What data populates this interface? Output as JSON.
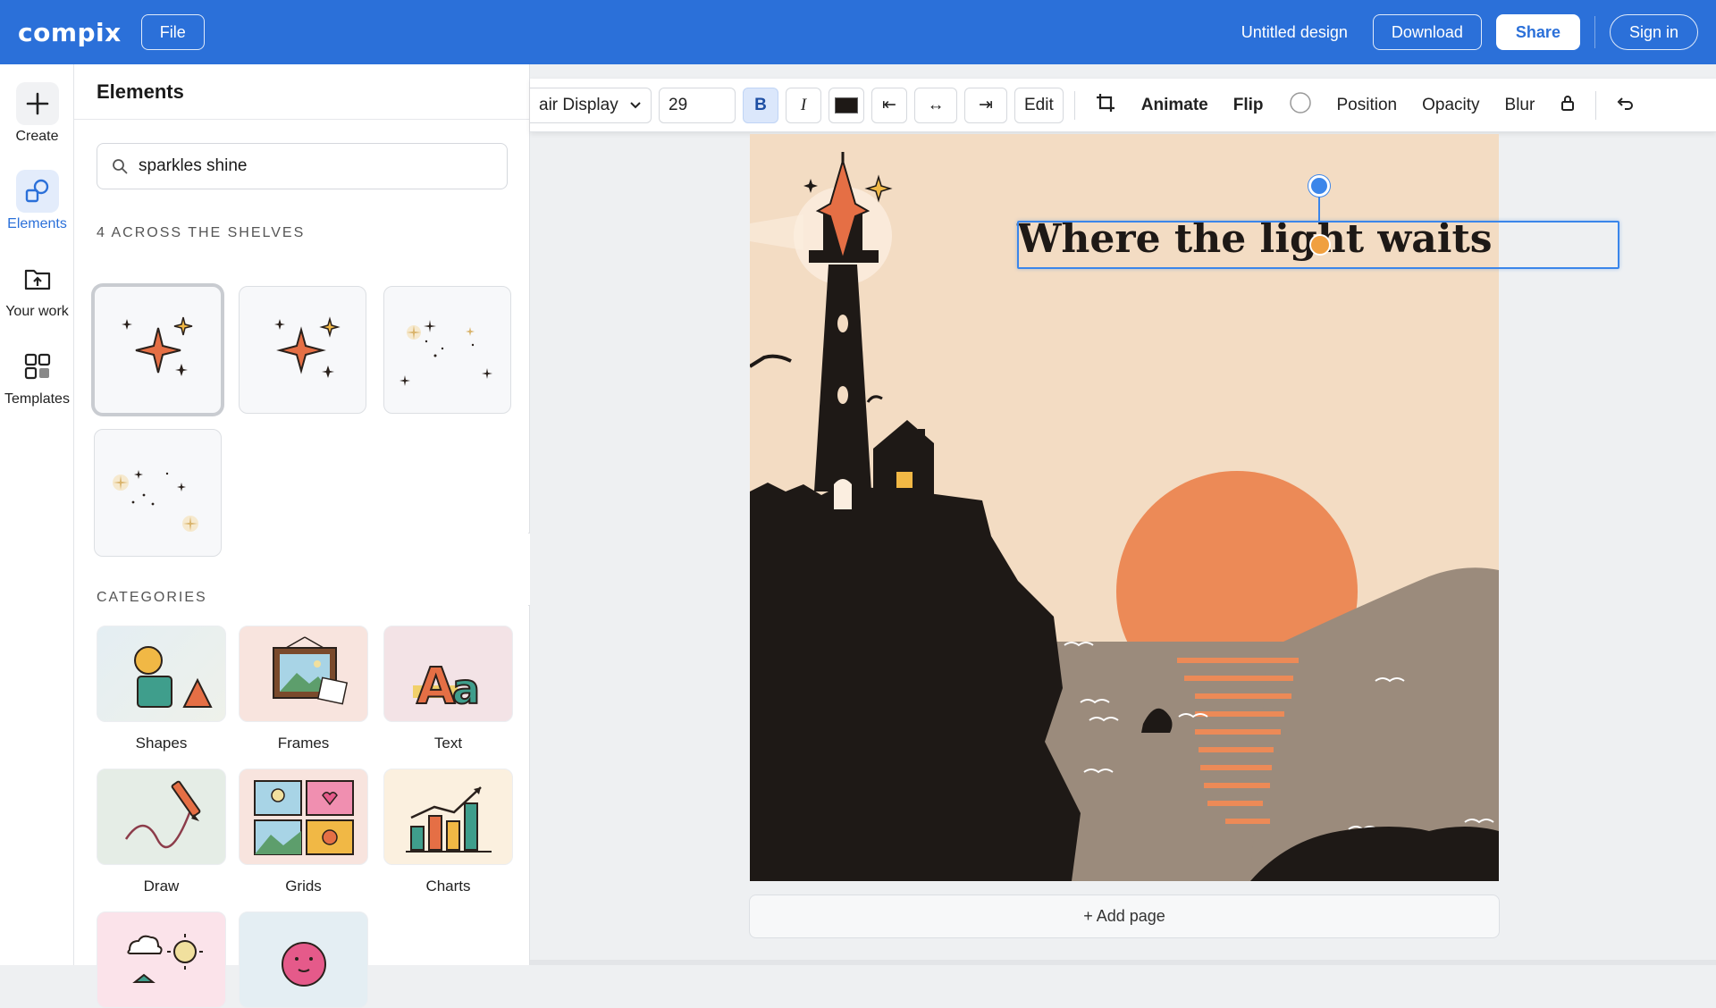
{
  "app": {
    "logo": "compix",
    "file_label": "File"
  },
  "header": {
    "doc_title": "Untitled design",
    "download": "Download",
    "share": "Share",
    "signin": "Sign in"
  },
  "rail": [
    {
      "label": "Create",
      "icon": "plus-icon"
    },
    {
      "label": "Elements",
      "icon": "shapes-icon",
      "active": true
    },
    {
      "label": "Your work",
      "icon": "folder-upload-icon"
    },
    {
      "label": "Templates",
      "icon": "grid-icon"
    }
  ],
  "panel": {
    "title": "Elements",
    "search_value": "sparkles shine",
    "results_label": "4 ACROSS THE SHELVES",
    "categories_label": "CATEGORIES",
    "categories": [
      "Shapes",
      "Frames",
      "Text",
      "Draw",
      "Grids",
      "Charts"
    ]
  },
  "toolbar": {
    "font": "air Display",
    "size": "29",
    "bold": "B",
    "italic": "I",
    "align_left": "⇤",
    "align_center": "↔",
    "align_right": "⇥",
    "edit": "Edit",
    "animate": "Animate",
    "flip": "Flip",
    "position": "Position",
    "opacity": "Opacity",
    "blur": "Blur"
  },
  "canvas": {
    "headline": "Where the light waits",
    "add_page": "+ Add page"
  },
  "colors": {
    "brand": "#2b70d9",
    "sky": "#f3dcc3",
    "sun": "#ec8a57",
    "silhouette": "#1e1916",
    "sea": "#9b8b7c"
  }
}
